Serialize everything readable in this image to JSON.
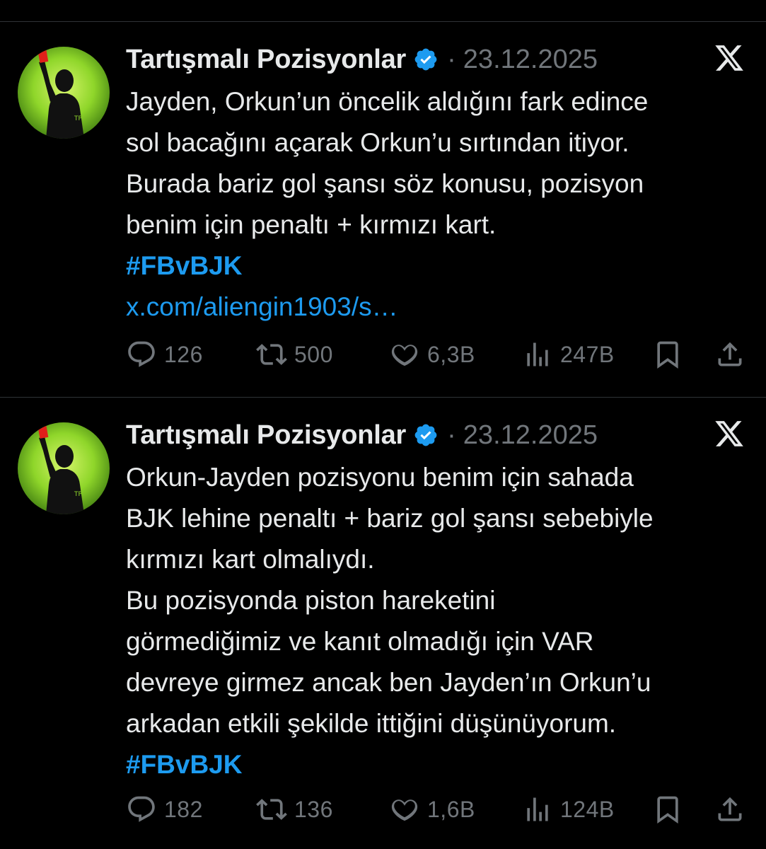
{
  "tweets": [
    {
      "author_name": "Tartışmalı Pozisyonlar",
      "separator": "·",
      "date": "23.12.2025",
      "avatar_text": "TP",
      "lines": [
        "Jayden, Orkun’un öncelik aldığını fark edince",
        "sol bacağını açarak Orkun’u sırtından itiyor.",
        "Burada bariz gol şansı söz konusu, pozisyon",
        "benim için penaltı + kırmızı kart."
      ],
      "hashtag": "#FBvBJK",
      "link": "x.com/aliengin1903/s…",
      "stats": {
        "replies": "126",
        "reposts": "500",
        "likes": "6,3B",
        "views": "247B"
      }
    },
    {
      "author_name": "Tartışmalı Pozisyonlar",
      "separator": "·",
      "date": "23.12.2025",
      "avatar_text": "TP",
      "lines": [
        "Orkun-Jayden pozisyonu benim için sahada",
        "BJK lehine penaltı + bariz gol şansı sebebiyle",
        "kırmızı kart olmalıydı.",
        "Bu pozisyonda piston hareketini",
        "görmediğimiz ve kanıt olmadığı için VAR",
        "devreye girmez ancak ben Jayden’ın Orkun’u",
        "arkadan etkili şekilde ittiğini düşünüyorum."
      ],
      "hashtag": "#FBvBJK",
      "stats": {
        "replies": "182",
        "reposts": "136",
        "likes": "1,6B",
        "views": "124B"
      }
    }
  ],
  "icons": {
    "verified": "verified-badge-icon",
    "x_logo": "x-logo-icon",
    "reply": "reply-icon",
    "repost": "repost-icon",
    "like": "heart-icon",
    "views": "views-icon",
    "bookmark": "bookmark-icon",
    "share": "share-icon"
  },
  "colors": {
    "background": "#000000",
    "text": "#e7e9ea",
    "muted": "#71767b",
    "accent": "#1d9bf0",
    "avatar_green": "#8fd62a"
  }
}
